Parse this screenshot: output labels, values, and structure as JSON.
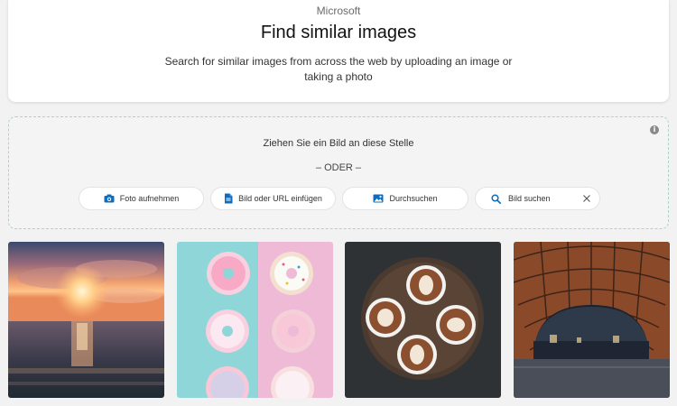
{
  "header": {
    "brand": "Microsoft",
    "title": "Find similar images",
    "subtitle": "Search for similar images from across the web by uploading an image or taking a photo"
  },
  "drop_zone": {
    "drag_text": "Ziehen Sie ein Bild an diese Stelle",
    "or_text": "– ODER –",
    "info_icon": "info-icon",
    "buttons": [
      {
        "label": "Foto aufnehmen",
        "icon": "camera-icon"
      },
      {
        "label": "Bild oder URL einfügen",
        "icon": "document-icon"
      },
      {
        "label": "Durchsuchen",
        "icon": "image-icon"
      }
    ],
    "search": {
      "label": "Bild suchen",
      "icon": "search-icon",
      "clear_icon": "close-icon"
    }
  },
  "gallery": [
    {
      "subject": "sunset over ocean"
    },
    {
      "subject": "donuts on blue and pink background"
    },
    {
      "subject": "latte art coffee cups"
    },
    {
      "subject": "wooden arch pavilion at night"
    }
  ],
  "colors": {
    "accent": "#0f6cbd",
    "drop_border": "#a9d3c7"
  }
}
